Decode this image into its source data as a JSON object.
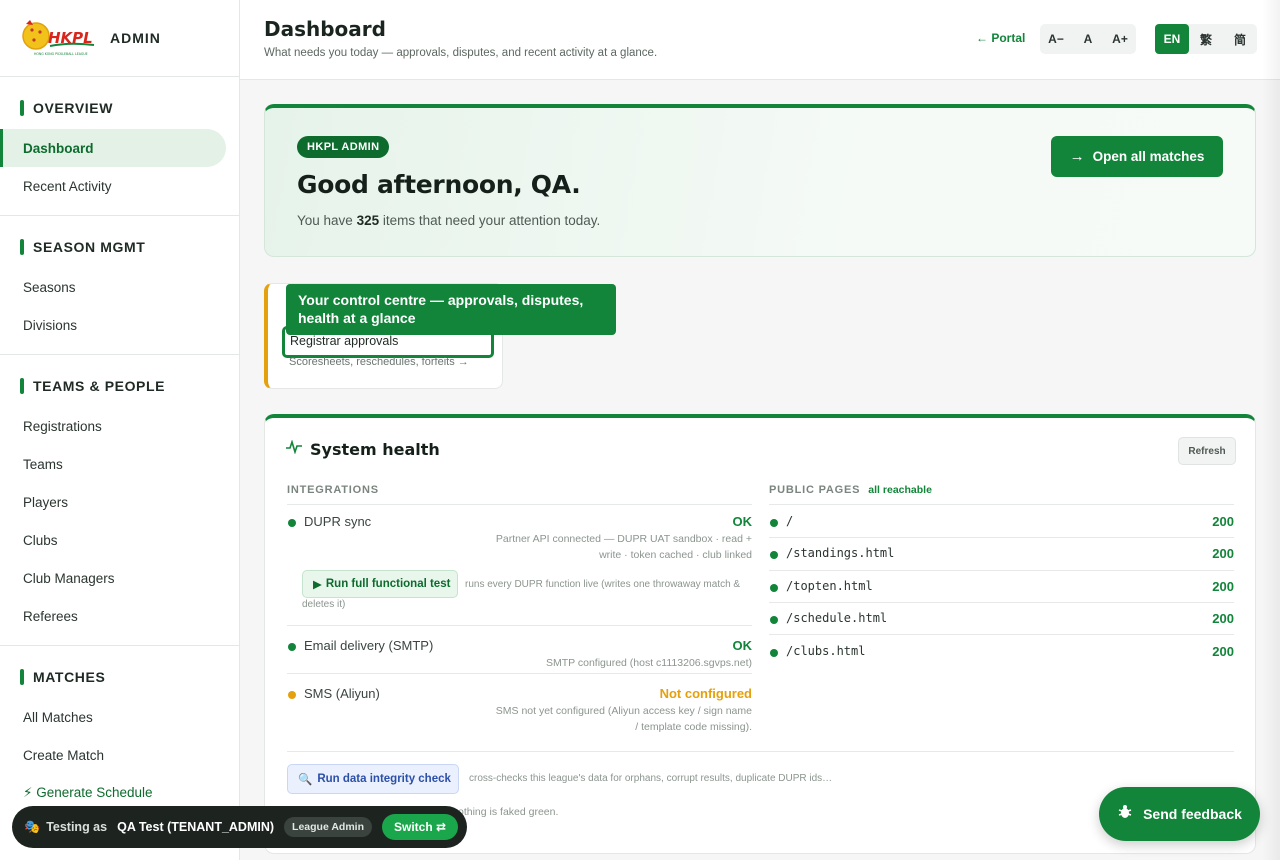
{
  "brand": {
    "logo_text": "HKPL",
    "logo_caption": "HONG KONG PICKLEBALL LEAGUE",
    "title": "ADMIN"
  },
  "sidebar": {
    "sections": [
      {
        "title": "OVERVIEW",
        "items": [
          {
            "label": "Dashboard",
            "active": true
          },
          {
            "label": "Recent Activity"
          }
        ]
      },
      {
        "title": "SEASON MGMT",
        "items": [
          {
            "label": "Seasons"
          },
          {
            "label": "Divisions"
          }
        ]
      },
      {
        "title": "TEAMS & PEOPLE",
        "items": [
          {
            "label": "Registrations"
          },
          {
            "label": "Teams"
          },
          {
            "label": "Players"
          },
          {
            "label": "Clubs"
          },
          {
            "label": "Club Managers"
          },
          {
            "label": "Referees"
          }
        ]
      },
      {
        "title": "MATCHES",
        "items": [
          {
            "label": "All Matches"
          },
          {
            "label": "Create Match"
          },
          {
            "label": "⚡ Generate Schedule"
          }
        ]
      }
    ]
  },
  "header": {
    "title": "Dashboard",
    "subtitle": "What needs you today — approvals, disputes, and recent activity at a glance.",
    "portal_label": "← Portal",
    "font_sizes": [
      "A−",
      "A",
      "A+"
    ],
    "languages": [
      "EN",
      "繁",
      "简"
    ],
    "active_language": "EN"
  },
  "hero": {
    "badge": "HKPL ADMIN",
    "greeting": "Good afternoon, QA.",
    "summary_prefix": "You have",
    "pending_count": "325",
    "summary_suffix": "items that need your attention today.",
    "button_label": "Open all matches"
  },
  "approvals": {
    "title": "Registrar approvals",
    "subtitle": "Scoresheets, reschedules, forfeits →"
  },
  "tooltip": {
    "text": "Your control centre — approvals, disputes, health at a glance"
  },
  "health": {
    "title": "System health",
    "refresh_label": "Refresh",
    "integrations_heading": "INTEGRATIONS",
    "integrations": [
      {
        "name": "DUPR sync",
        "status": "OK",
        "detail_1": "Partner API connected — DUPR UAT sandbox · read +",
        "detail_2": "write · token cached · club linked"
      },
      {
        "name": "Email delivery (SMTP)",
        "status": "OK",
        "detail_1": "SMTP configured (host c1113206.sgvps.net)"
      },
      {
        "name": "SMS (Aliyun)",
        "status": "Not configured",
        "detail_1": "SMS not yet configured (Aliyun access key / sign name",
        "detail_2": "/ template code missing)."
      }
    ],
    "functional_test_label": "Run full functional test",
    "functional_test_note": "runs every DUPR function live (writes one throwaway match & deletes it)",
    "public_heading": "PUBLIC PAGES",
    "public_note": "all reachable",
    "public_pages": [
      {
        "path": "/",
        "code": "200"
      },
      {
        "path": "/standings.html",
        "code": "200"
      },
      {
        "path": "/topten.html",
        "code": "200"
      },
      {
        "path": "/schedule.html",
        "code": "200"
      },
      {
        "path": "/clubs.html",
        "code": "200"
      }
    ],
    "integrity_label": "Run data integrity check",
    "integrity_note": "cross-checks this league's data for orphans, corrupt results, duplicate DUPR ids…",
    "footnote": "tatuses reflect real configuration — nothing is faked green."
  },
  "testing_bar": {
    "prefix": "Testing as",
    "user": "QA Test (TENANT_ADMIN)",
    "role": "League Admin",
    "switch_label": "Switch ⇄"
  },
  "feedback": {
    "label": "Send feedback"
  },
  "colors": {
    "primary": "#12853a",
    "warning": "#e5a00d",
    "info": "#2c4fa8"
  }
}
